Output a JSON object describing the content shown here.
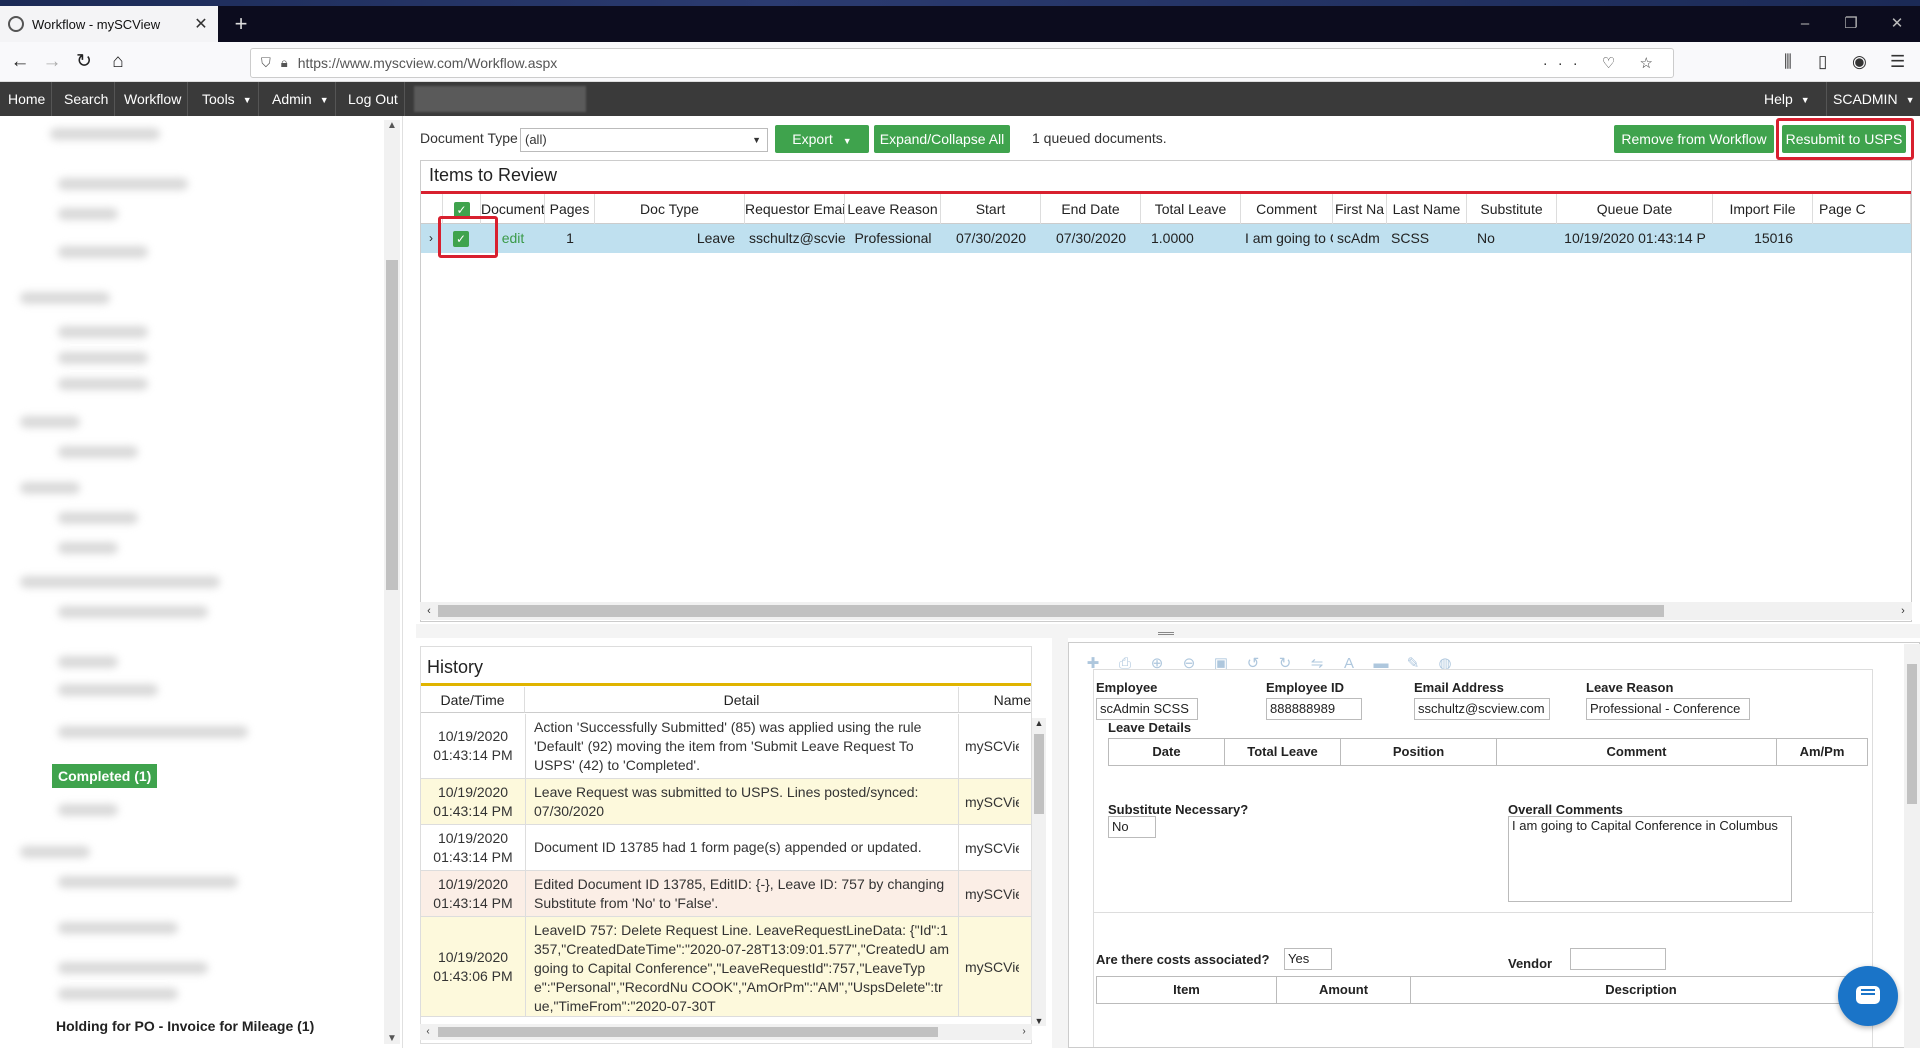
{
  "browser": {
    "tab_title": "Workflow - mySCView",
    "url": "https://www.myscview.com/Workflow.aspx",
    "new_tab_glyph": "+",
    "window_controls": [
      "–",
      "❐",
      "✕"
    ]
  },
  "menu": {
    "items": [
      "Home",
      "Search",
      "Workflow",
      "Tools",
      "Admin",
      "Log Out"
    ],
    "right_items": [
      "Help",
      "SCADMIN"
    ]
  },
  "sidebar": {
    "completed_label": "Completed (1)",
    "holding_label": "Holding for PO - Invoice for Mileage (1)"
  },
  "toolbar": {
    "doctype_label": "Document Type",
    "doctype_value": "(all)",
    "export_label": "Export",
    "expand_label": "Expand/Collapse All",
    "queued_text": "1 queued documents.",
    "remove_label": "Remove from Workflow",
    "resubmit_label": "Resubmit to USPS"
  },
  "review": {
    "title": "Items to Review",
    "columns": [
      "Document",
      "Pages",
      "Doc Type",
      "Requestor Emai",
      "Leave Reason",
      "Start",
      "End Date",
      "Total Leave",
      "Comment",
      "First Na",
      "Last Name",
      "Substitute",
      "Queue Date",
      "Import File",
      "Page C"
    ],
    "row": {
      "document": "edit",
      "pages": "1",
      "doc_type": "Leave",
      "requestor_email": "sschultz@scvie",
      "leave_reason": "Professional",
      "start": "07/30/2020",
      "end_date": "07/30/2020",
      "total_leave": "1.0000",
      "comment": "I am going to C",
      "first_name": "scAdm",
      "last_name": "SCSS",
      "substitute": "No",
      "queue_date": "10/19/2020 01:43:14 P",
      "import_file": "15016"
    }
  },
  "history": {
    "title": "History",
    "columns": [
      "Date/Time",
      "Detail",
      "Name"
    ],
    "rows": [
      {
        "date": "10/19/2020",
        "time": "01:43:14 PM",
        "detail": "Action 'Successfully Submitted' (85) was applied using the rule 'Default' (92) moving the item from 'Submit Leave Request To USPS' (42) to 'Completed'.",
        "name": "mySCView",
        "bg": "#ffffff"
      },
      {
        "date": "10/19/2020",
        "time": "01:43:14 PM",
        "detail": "Leave Request was submitted to USPS. Lines posted/synced: 07/30/2020",
        "name": "mySCView",
        "bg": "#fdf9dc"
      },
      {
        "date": "10/19/2020",
        "time": "01:43:14 PM",
        "detail": "Document ID 13785 had 1 form page(s) appended or updated.",
        "name": "mySCView",
        "bg": "#ffffff"
      },
      {
        "date": "10/19/2020",
        "time": "01:43:14 PM",
        "detail": "Edited Document ID 13785, EditID: {-}, Leave ID: 757 by changing Substitute from 'No' to 'False'.",
        "name": "mySCView",
        "bg": "#fbeee6"
      },
      {
        "date": "10/19/2020",
        "time": "01:43:06 PM",
        "detail": "LeaveID 757: Delete Request Line. LeaveRequestLineData: {\"Id\":1357,\"CreatedDateTime\":\"2020-07-28T13:09:01.577\",\"CreatedU am going to Capital Conference\",\"LeaveRequestId\":757,\"LeaveType\":\"Personal\",\"RecordNu COOK\",\"AmOrPm\":\"AM\",\"UspsDelete\":true,\"TimeFrom\":\"2020-07-30T",
        "name": "mySCView",
        "bg": "#fdf9dc"
      }
    ]
  },
  "form": {
    "employee_label": "Employee",
    "employee_value": "scAdmin SCSS",
    "employee_id_label": "Employee ID",
    "employee_id_value": "888888989",
    "email_label": "Email Address",
    "email_value": "sschultz@scview.com",
    "leave_reason_label": "Leave Reason",
    "leave_reason_value": "Professional - Conference",
    "leave_details_label": "Leave Details",
    "details_columns": [
      "Date",
      "Total Leave",
      "Position",
      "Comment",
      "Am/Pm"
    ],
    "substitute_label": "Substitute Necessary?",
    "substitute_value": "No",
    "overall_label": "Overall Comments",
    "overall_value": "I am going to Capital Conference in Columbus",
    "costs_label": "Are there costs associated?",
    "costs_value": "Yes",
    "vendor_label": "Vendor",
    "cost_columns": [
      "Item",
      "Amount",
      "Description"
    ]
  }
}
